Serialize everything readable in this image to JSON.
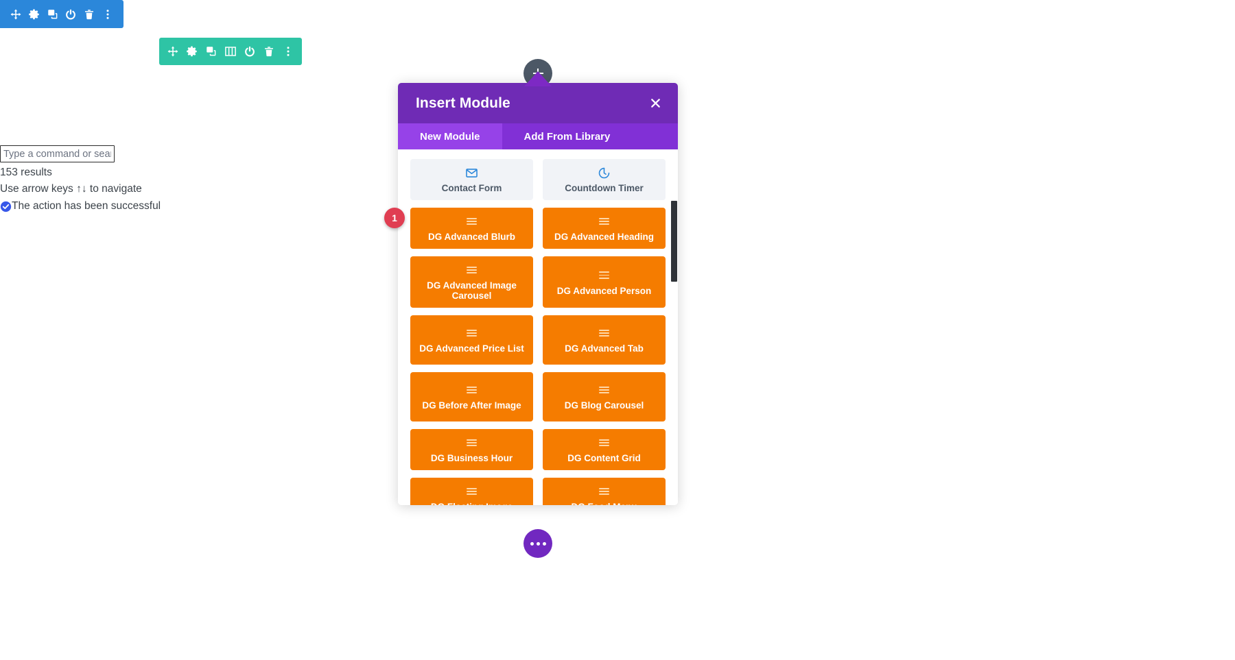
{
  "module_toolbar": {
    "background": "#2b87da",
    "icons": [
      {
        "name": "move-icon",
        "glyph": "move"
      },
      {
        "name": "settings-gear-icon",
        "glyph": "gear"
      },
      {
        "name": "duplicate-icon",
        "glyph": "duplicate"
      },
      {
        "name": "power-toggle-icon",
        "glyph": "power"
      },
      {
        "name": "delete-trash-icon",
        "glyph": "trash"
      },
      {
        "name": "more-options-icon",
        "glyph": "dots-vertical"
      }
    ]
  },
  "row_toolbar": {
    "background": "#2ec4a5",
    "icons": [
      {
        "name": "move-icon",
        "glyph": "move"
      },
      {
        "name": "settings-gear-icon",
        "glyph": "gear"
      },
      {
        "name": "duplicate-icon",
        "glyph": "duplicate"
      },
      {
        "name": "column-structure-icon",
        "glyph": "columns"
      },
      {
        "name": "power-toggle-icon",
        "glyph": "power"
      },
      {
        "name": "delete-trash-icon",
        "glyph": "trash"
      },
      {
        "name": "more-options-icon",
        "glyph": "dots-vertical"
      }
    ]
  },
  "palette": {
    "search_placeholder": "Type a command or search",
    "search_value": "",
    "results_count": "153 results",
    "nav_hint": "Use arrow keys ↑↓ to navigate",
    "status_message": "The action has been successful",
    "status_icon": "check-circle-icon",
    "status_icon_color": "#3858e9"
  },
  "step_badge": {
    "label": "1",
    "color": "#e03e52"
  },
  "add_module_button": {
    "name": "add-module-plus-button",
    "color": "#4c5866"
  },
  "page_settings_button": {
    "name": "page-settings-button",
    "color": "#7128c0"
  },
  "modal": {
    "title": "Insert Module",
    "header_color": "#6f2bb5",
    "close_label": "×",
    "tabs": [
      {
        "label": "New Module",
        "active": true
      },
      {
        "label": "Add From Library",
        "active": false
      }
    ],
    "scrollbar": {
      "thumb_color": "#2f3338"
    },
    "modules": [
      {
        "label": "Contact Form",
        "type": "core",
        "icon": "envelope-icon",
        "tall": false
      },
      {
        "label": "Countdown Timer",
        "type": "core",
        "icon": "clock-icon",
        "tall": false
      },
      {
        "label": "DG Advanced Blurb",
        "type": "dg",
        "icon": "hamburger-icon",
        "tall": false
      },
      {
        "label": "DG Advanced Heading",
        "type": "dg",
        "icon": "hamburger-icon",
        "tall": false
      },
      {
        "label": "DG Advanced Image Carousel",
        "type": "dg",
        "icon": "hamburger-icon",
        "tall": true
      },
      {
        "label": "DG Advanced Person",
        "type": "dg",
        "icon": "hamburger-icon",
        "tall": false
      },
      {
        "label": "DG Advanced Price List",
        "type": "dg",
        "icon": "hamburger-icon",
        "tall": true
      },
      {
        "label": "DG Advanced Tab",
        "type": "dg",
        "icon": "hamburger-icon",
        "tall": false
      },
      {
        "label": "DG Before After Image",
        "type": "dg",
        "icon": "hamburger-icon",
        "tall": true
      },
      {
        "label": "DG Blog Carousel",
        "type": "dg",
        "icon": "hamburger-icon",
        "tall": false
      },
      {
        "label": "DG Business Hour",
        "type": "dg",
        "icon": "hamburger-icon",
        "tall": false
      },
      {
        "label": "DG Content Grid",
        "type": "dg",
        "icon": "hamburger-icon",
        "tall": false
      },
      {
        "label": "DG Floating Image",
        "type": "dg",
        "icon": "hamburger-icon",
        "tall": false
      },
      {
        "label": "DG Food Menu",
        "type": "dg",
        "icon": "hamburger-icon",
        "tall": false
      }
    ]
  }
}
